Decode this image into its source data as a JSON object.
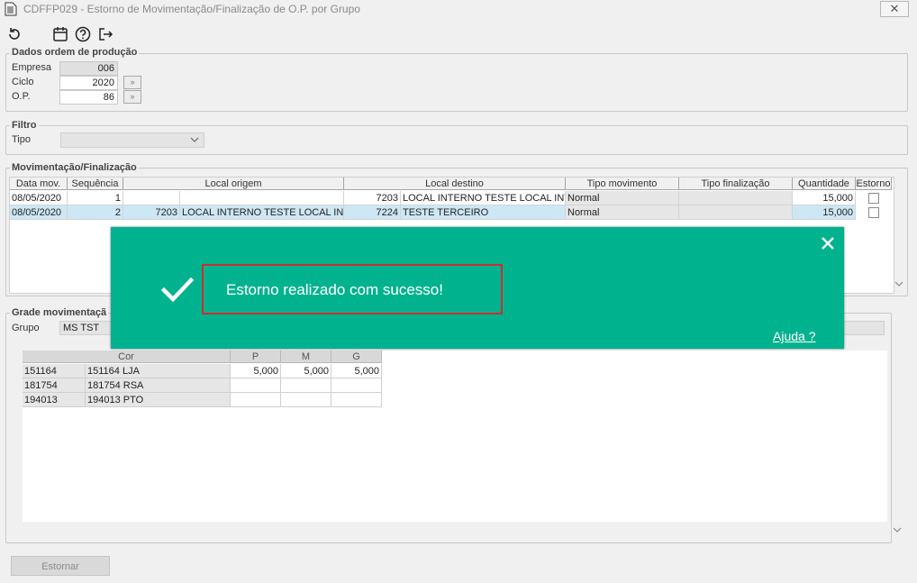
{
  "window": {
    "title": "CDFFP029 - Estorno de Movimentação/Finalização de O.P. por Grupo",
    "close": "✕"
  },
  "toolbar": {
    "icons": [
      "refresh-icon",
      "calendar-icon",
      "help-icon",
      "exit-icon"
    ]
  },
  "dados": {
    "legend": "Dados ordem de produção",
    "empresa_label": "Empresa",
    "empresa_value": "006",
    "ciclo_label": "Ciclo",
    "ciclo_value": "2020",
    "op_label": "O.P.",
    "op_value": "86"
  },
  "filtro": {
    "legend": "Filtro",
    "tipo_label": "Tipo",
    "tipo_value": ""
  },
  "mov": {
    "legend": "Movimentação/Finalização",
    "headers": [
      "Data mov.",
      "Sequência",
      "Local origem",
      "Local destino",
      "Tipo movimento",
      "Tipo finalização",
      "Quantidade",
      "Estorno"
    ],
    "rows": [
      {
        "data": "08/05/2020",
        "seq": "1",
        "orig_cod": "",
        "orig_desc": "",
        "dest_cod": "7203",
        "dest_desc": "LOCAL INTERNO TESTE LOCAL INTE",
        "tipo_mov": "Normal",
        "tipo_fin": "",
        "qtd": "15,000"
      },
      {
        "data": "08/05/2020",
        "seq": "2",
        "orig_cod": "7203",
        "orig_desc": "LOCAL INTERNO TESTE LOCAL INTE",
        "dest_cod": "7224",
        "dest_desc": "TESTE TERCEIRO",
        "tipo_mov": "Normal",
        "tipo_fin": "",
        "qtd": "15,000"
      }
    ]
  },
  "grade": {
    "legend": "Grade movimentaçã",
    "grupo_label": "Grupo",
    "grupo_value": "MS TST",
    "cor_header": "Cor",
    "sizes": [
      "P",
      "M",
      "G"
    ],
    "rows": [
      {
        "cod": "151164",
        "desc": "151164 LJA",
        "values": [
          "5,000",
          "5,000",
          "5,000"
        ]
      },
      {
        "cod": "181754",
        "desc": "181754 RSA",
        "values": [
          "",
          "",
          ""
        ]
      },
      {
        "cod": "194013",
        "desc": "194013 PTO",
        "values": [
          "",
          "",
          ""
        ]
      }
    ]
  },
  "toast": {
    "message": "Estorno realizado com sucesso!",
    "help": "Ajuda ?",
    "bg": "#01b28e"
  },
  "actions": {
    "estornar": "Estornar"
  }
}
